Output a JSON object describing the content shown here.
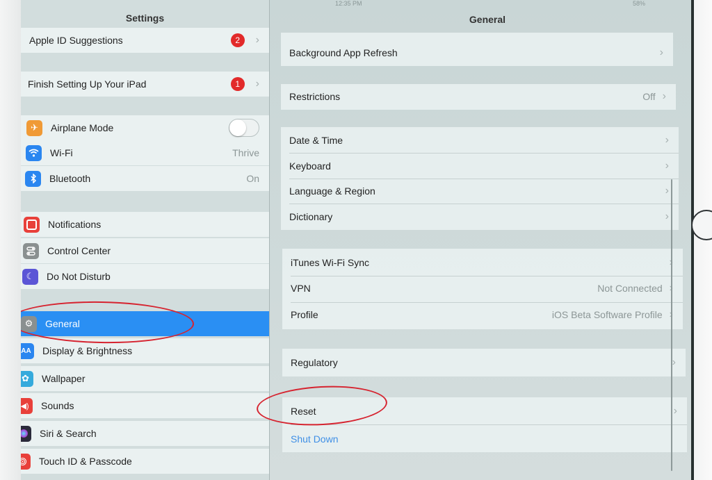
{
  "status_bar": {
    "device": "iPad",
    "time": "12:35 PM",
    "battery": "58%"
  },
  "master": {
    "title": "Settings",
    "rows": [
      {
        "label": "Apple ID Suggestions",
        "badge": "2"
      },
      {
        "label": "Finish Setting Up Your iPad",
        "badge": "1"
      },
      {
        "label": "Airplane Mode",
        "icon": "airplane-icon",
        "color": "#f09a36"
      },
      {
        "label": "Wi-Fi",
        "value": "Thrive",
        "icon": "wifi-icon",
        "color": "#2a86f0"
      },
      {
        "label": "Bluetooth",
        "value": "On",
        "icon": "bluetooth-icon",
        "color": "#2a86f0"
      },
      {
        "label": "Notifications",
        "icon": "notifications-icon",
        "color": "#e8403a"
      },
      {
        "label": "Control Center",
        "icon": "control-center-icon",
        "color": "#8a9090"
      },
      {
        "label": "Do Not Disturb",
        "icon": "moon-icon",
        "color": "#5b55d6"
      },
      {
        "label": "General",
        "icon": "gear-icon",
        "color": "#8a9090"
      },
      {
        "label": "Display & Brightness",
        "icon": "display-icon",
        "color": "#2a86f0"
      },
      {
        "label": "Wallpaper",
        "icon": "wallpaper-icon",
        "color": "#35aadc"
      },
      {
        "label": "Sounds",
        "icon": "speaker-icon",
        "color": "#e8403a"
      },
      {
        "label": "Siri & Search",
        "icon": "siri-icon",
        "color": "#2a2a3a"
      },
      {
        "label": "Touch ID & Passcode",
        "icon": "fingerprint-icon",
        "color": "#e8403a"
      }
    ],
    "selected": "General"
  },
  "detail": {
    "title": "General",
    "rows": [
      {
        "label": "Background App Refresh"
      },
      {
        "label": "Restrictions",
        "value": "Off"
      },
      {
        "label": "Date & Time"
      },
      {
        "label": "Keyboard"
      },
      {
        "label": "Language & Region"
      },
      {
        "label": "Dictionary"
      },
      {
        "label": "iTunes Wi-Fi Sync"
      },
      {
        "label": "VPN",
        "value": "Not Connected"
      },
      {
        "label": "Profile",
        "value": "iOS Beta Software Profile"
      },
      {
        "label": "Regulatory"
      },
      {
        "label": "Reset"
      },
      {
        "label": "Shut Down"
      }
    ]
  },
  "annotations": {
    "color": "#d6232f",
    "circled": [
      "General",
      "Reset"
    ]
  },
  "colors": {
    "accent": "#2a8ff3",
    "badge": "#e22a2a",
    "link": "#3f8fe6"
  }
}
